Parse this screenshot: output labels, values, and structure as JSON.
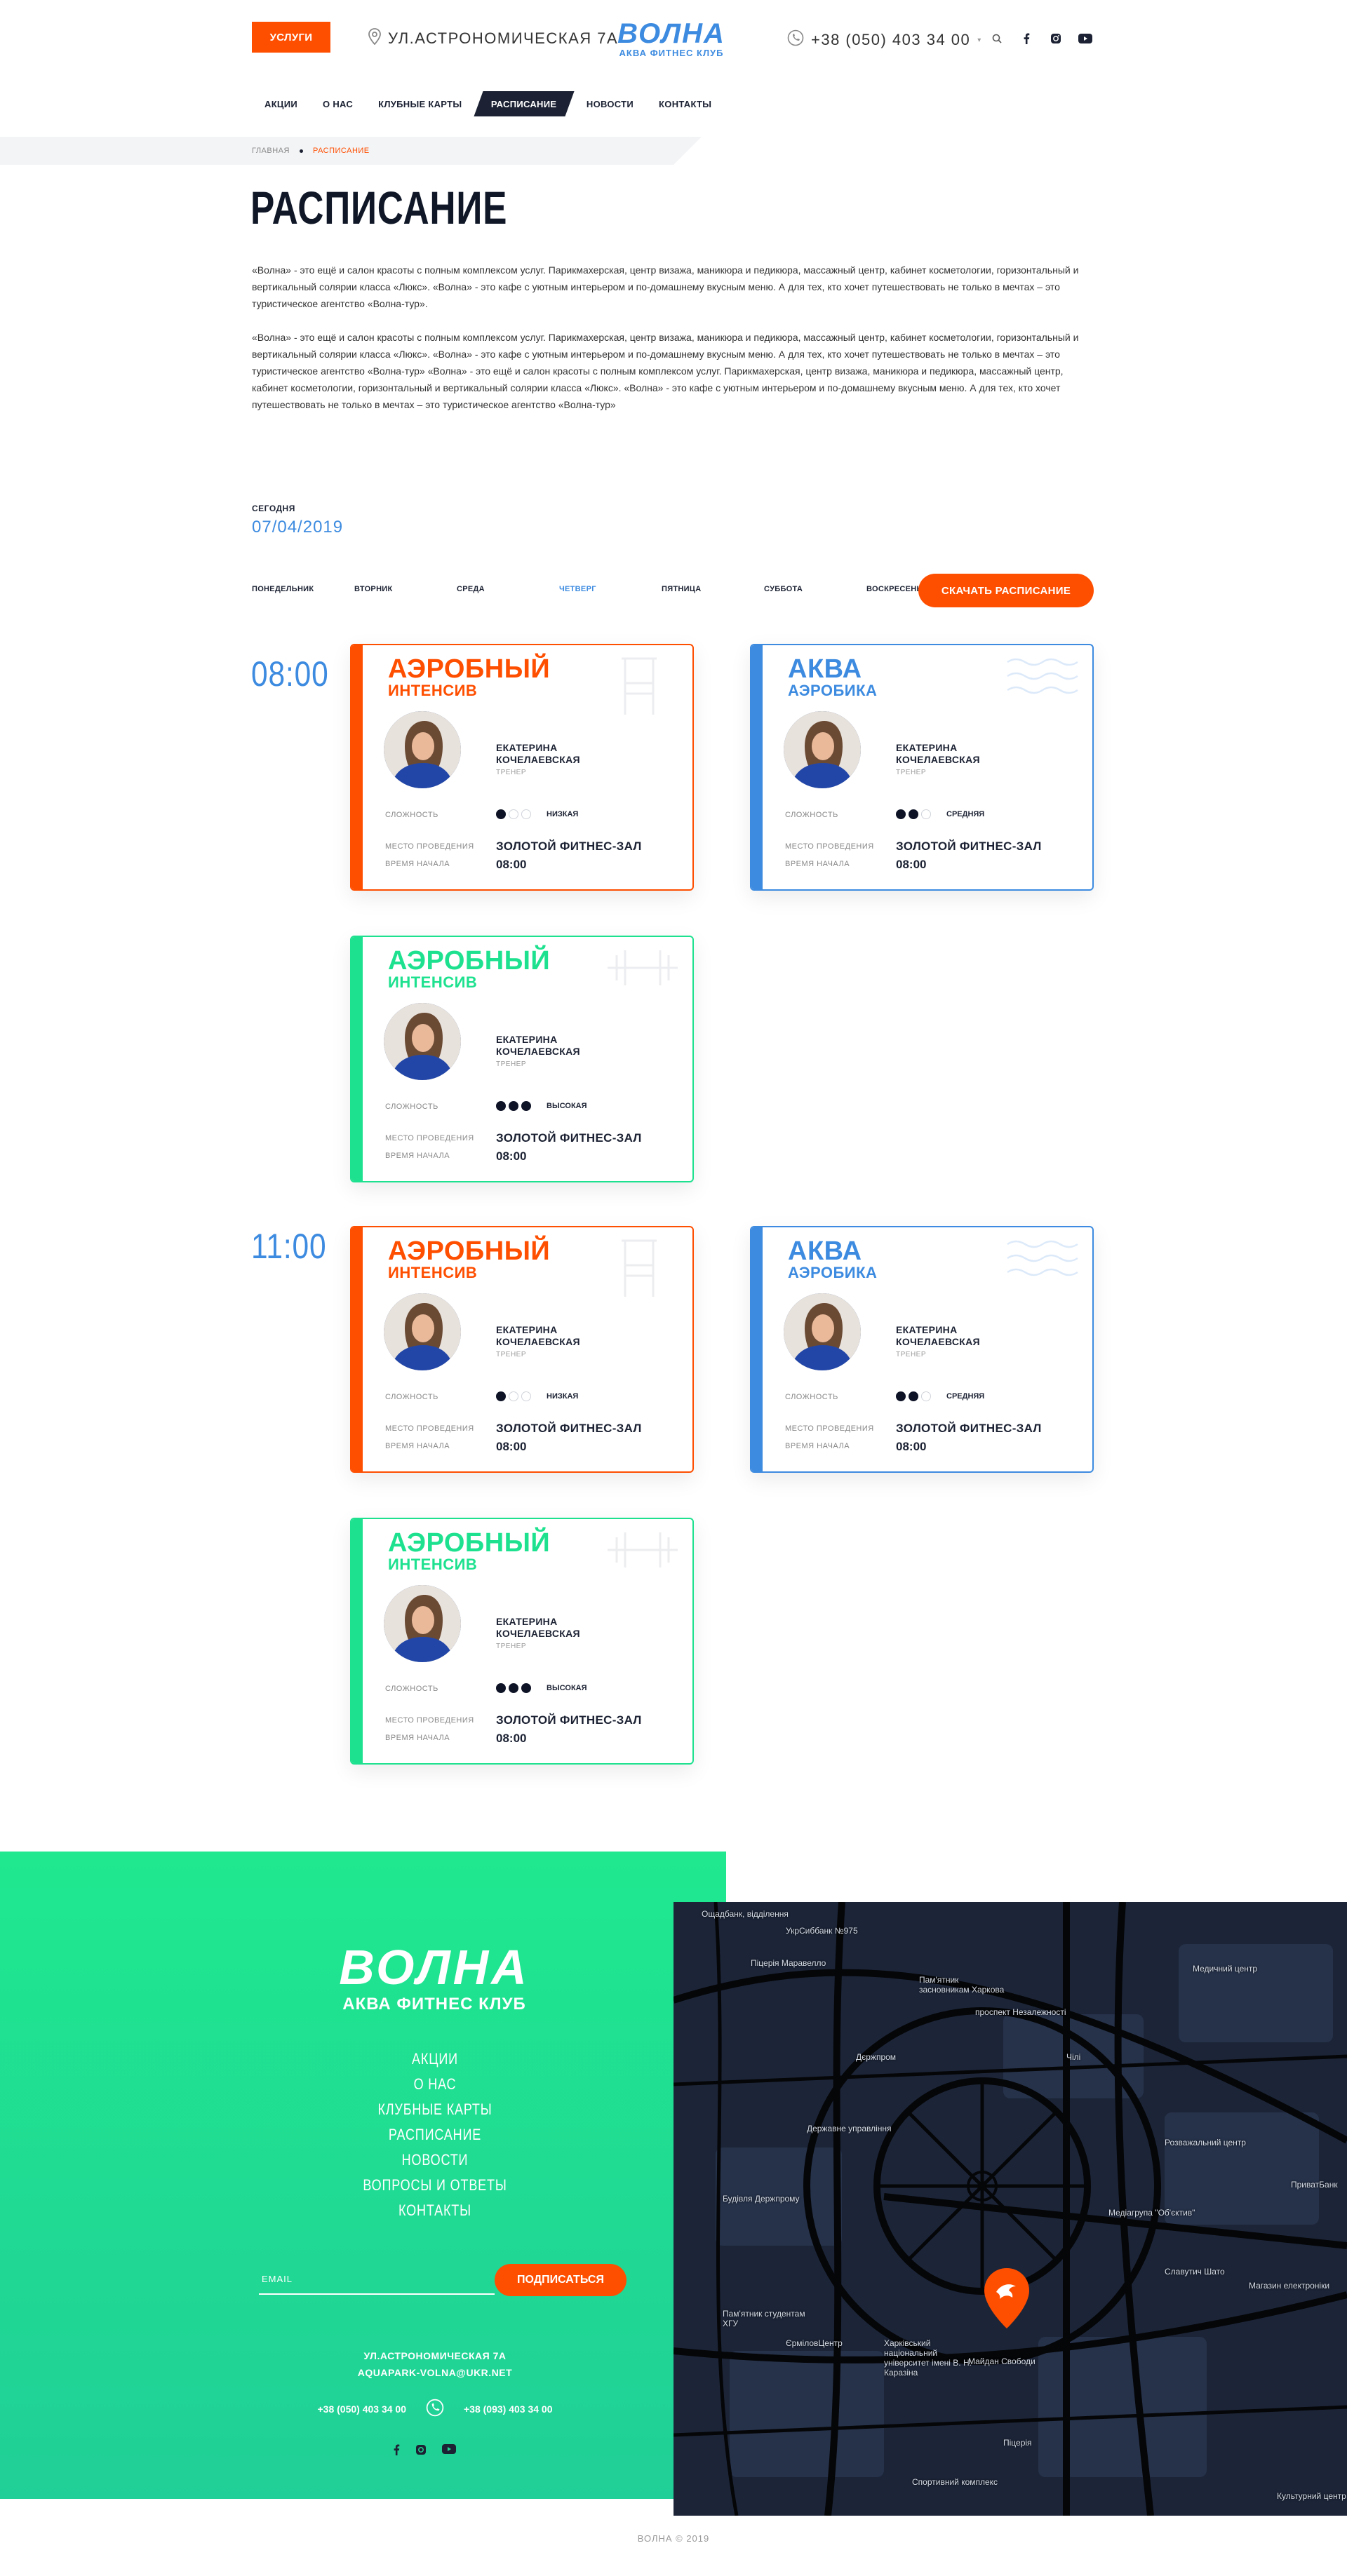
{
  "header": {
    "services_label": "УСЛУГИ",
    "address": "УЛ.АСТРОНОМИЧЕСКАЯ 7А",
    "logo_main": "ВОЛНА",
    "logo_sub": "АКВА ФИТНЕС КЛУБ",
    "phone": "+38 (050) 403 34 00"
  },
  "nav": [
    "АКЦИИ",
    "О НАС",
    "КЛУБНЫЕ КАРТЫ",
    "РАСПИСАНИЕ",
    "НОВОСТИ",
    "КОНТАКТЫ"
  ],
  "breadcrumbs": {
    "home": "ГЛАВНАЯ",
    "current": "РАСПИСАНИЕ"
  },
  "page_title": "РАСПИСАНИЕ",
  "intro": [
    "«Волна» - это ещё и салон красоты с полным комплексом услуг. Парикмахерская, центр визажа, маникюра и педикюра, массажный центр, кабинет косметологии, горизонтальный и вертикальный солярии класса «Люкс». «Волна» - это кафе с уютным интерьером и по-домашнему вкусным меню. А для тех, кто хочет путешествовать не только в мечтах – это туристическое агентство «Волна-тур».",
    "«Волна» - это ещё и салон красоты с полным комплексом услуг. Парикмахерская, центр визажа, маникюра и педикюра, массажный центр, кабинет косметологии, горизонтальный и вертикальный солярии класса «Люкс». «Волна» - это кафе с уютным интерьером и по-домашнему вкусным меню. А для тех, кто хочет путешествовать не только в мечтах – это туристическое агентство «Волна-тур» «Волна» - это ещё и салон красоты с полным комплексом услуг. Парикмахерская, центр визажа, маникюра и педикюра, массажный центр, кабинет косметологии, горизонтальный и вертикальный солярии класса «Люкс». «Волна» - это кафе с уютным интерьером и по-домашнему вкусным меню. А для тех, кто хочет путешествовать не только в мечтах – это туристическое агентство «Волна-тур»"
  ],
  "today": {
    "label": "СЕГОДНЯ",
    "date": "07/04/2019"
  },
  "days": [
    "ПОНЕДЕЛЬНИК",
    "ВТОРНИК",
    "СРЕДА",
    "ЧЕТВЕРГ",
    "ПЯТНИЦА",
    "СУББОТА",
    "ВОСКРЕСЕНЬЕ"
  ],
  "active_day": "ЧЕТВЕРГ",
  "download_label": "СКАЧАТЬ РАСПИСАНИЕ",
  "times": [
    "08:00",
    "11:00"
  ],
  "card_labels": {
    "difficulty": "СЛОЖНОСТЬ",
    "place": "МЕСТО ПРОВЕДЕНИЯ",
    "start": "ВРЕМЯ НАЧАЛА"
  },
  "cards": [
    {
      "t1": "АЭРОБНЫЙ",
      "t2": "ИНТЕНСИВ",
      "color": "#fe4e00",
      "trainer": "ЕКАТЕРИНА КОЧЕЛАЕВСКАЯ",
      "role": "ТРЕНЕР",
      "level": "НИЗКАЯ",
      "dots": 1,
      "place": "ЗОЛОТОЙ ФИТНЕС-ЗАЛ",
      "start": "08:00",
      "deco": "chair-icon"
    },
    {
      "t1": "АКВА",
      "t2": "АЭРОБИКА",
      "color": "#3d8be0",
      "trainer": "ЕКАТЕРИНА КОЧЕЛАЕВСКАЯ",
      "role": "ТРЕНЕР",
      "level": "СРЕДНЯЯ",
      "dots": 2,
      "place": "ЗОЛОТОЙ ФИТНЕС-ЗАЛ",
      "start": "08:00",
      "deco": "waves-icon"
    },
    {
      "t1": "АЭРОБНЫЙ",
      "t2": "ИНТЕНСИВ",
      "color": "#1ee18f",
      "trainer": "ЕКАТЕРИНА КОЧЕЛАЕВСКАЯ",
      "role": "ТРЕНЕР",
      "level": "ВЫСОКАЯ",
      "dots": 3,
      "place": "ЗОЛОТОЙ ФИТНЕС-ЗАЛ",
      "start": "08:00",
      "deco": "dumbbell-icon"
    },
    {
      "t1": "АЭРОБНЫЙ",
      "t2": "ИНТЕНСИВ",
      "color": "#fe4e00",
      "trainer": "ЕКАТЕРИНА КОЧЕЛАЕВСКАЯ",
      "role": "ТРЕНЕР",
      "level": "НИЗКАЯ",
      "dots": 1,
      "place": "ЗОЛОТОЙ ФИТНЕС-ЗАЛ",
      "start": "08:00",
      "deco": "chair-icon"
    },
    {
      "t1": "АКВА",
      "t2": "АЭРОБИКА",
      "color": "#3d8be0",
      "trainer": "ЕКАТЕРИНА КОЧЕЛАЕВСКАЯ",
      "role": "ТРЕНЕР",
      "level": "СРЕДНЯЯ",
      "dots": 2,
      "place": "ЗОЛОТОЙ ФИТНЕС-ЗАЛ",
      "start": "08:00",
      "deco": "waves-icon"
    },
    {
      "t1": "АЭРОБНЫЙ",
      "t2": "ИНТЕНСИВ",
      "color": "#1ee18f",
      "trainer": "ЕКАТЕРИНА КОЧЕЛАЕВСКАЯ",
      "role": "ТРЕНЕР",
      "level": "ВЫСОКАЯ",
      "dots": 3,
      "place": "ЗОЛОТОЙ ФИТНЕС-ЗАЛ",
      "start": "08:00",
      "deco": "dumbbell-icon"
    }
  ],
  "footer": {
    "logo_main": "ВОЛНА",
    "logo_sub": "АКВА ФИТНЕС КЛУБ",
    "nav": [
      "АКЦИИ",
      "О НАС",
      "КЛУБНЫЕ КАРТЫ",
      "РАСПИСАНИЕ",
      "НОВОСТИ",
      "ВОПРОСЫ И ОТВЕТЫ",
      "КОНТАКТЫ"
    ],
    "email_placeholder": "EMAIL",
    "subscribe_label": "ПОДПИСАТЬСЯ",
    "address": "УЛ.АСТРОНОМИЧЕСКАЯ 7А",
    "email": "AQUAPARK-VOLNA@UKR.NET",
    "phone1": "+38 (050) 403 34 00",
    "phone2": "+38 (093) 403 34 00",
    "copyright": "ВОЛНА © 2019"
  },
  "map_labels": [
    "Ощадбанк, відділення",
    "УкрСиббанк №975",
    "Піцерія Маравелло",
    "Пам'ятник засновникам Харкова",
    "проспект Незалежності",
    "Медичний центр",
    "Дєржпром",
    "Чілі",
    "Державне управління",
    "Розважальний центр",
    "ПриватБанк",
    "Будівля Держпрому",
    "Медіагрупа \"Об'єктив\"",
    "Славутич Шато",
    "Магазин електроніки",
    "Пам'ятник студентам ХГУ",
    "ЄрміловЦентр",
    "Харківський національний університет імені В. Н. Каразіна",
    "Майдан Свободи",
    "Піцерія",
    "Спортивний комплекс",
    "Культурний центр"
  ]
}
